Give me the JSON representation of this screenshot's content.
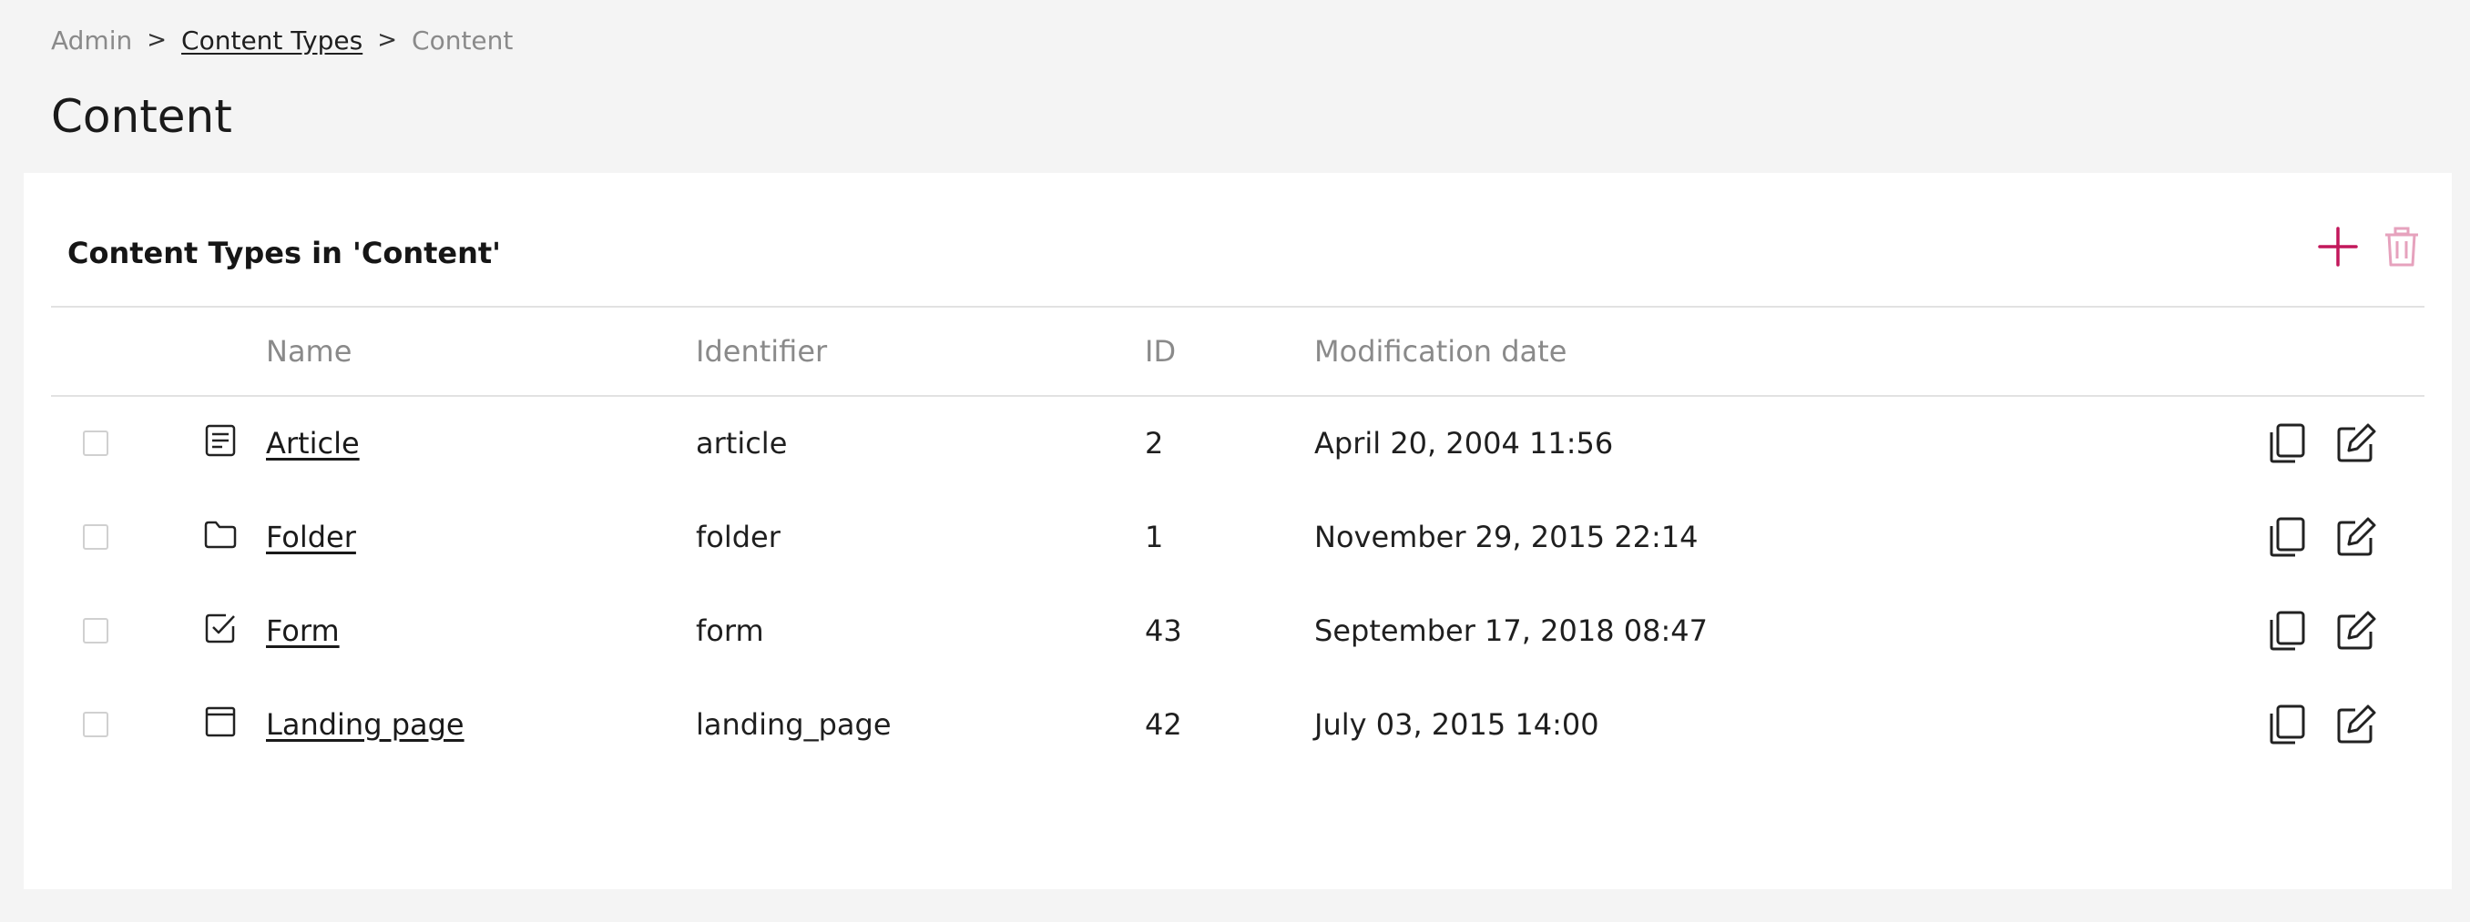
{
  "breadcrumb": {
    "items": [
      {
        "label": "Admin",
        "link": false
      },
      {
        "label": "Content Types",
        "link": true
      },
      {
        "label": "Content",
        "link": false
      }
    ],
    "separator": ">"
  },
  "page": {
    "title": "Content"
  },
  "card": {
    "title": "Content Types in 'Content'",
    "actions": [
      {
        "name": "add",
        "icon": "plus-icon"
      },
      {
        "name": "delete",
        "icon": "trash-icon",
        "disabled": true
      }
    ]
  },
  "table": {
    "columns": [
      "Name",
      "Identifier",
      "ID",
      "Modification date"
    ],
    "rows": [
      {
        "name": "Article",
        "identifier": "article",
        "id": "2",
        "date": "April 20, 2004 11:56",
        "icon": "article-icon"
      },
      {
        "name": "Folder",
        "identifier": "folder",
        "id": "1",
        "date": "November 29, 2015 22:14",
        "icon": "folder-icon"
      },
      {
        "name": "Form",
        "identifier": "form",
        "id": "43",
        "date": "September 17, 2018 08:47",
        "icon": "form-icon"
      },
      {
        "name": "Landing page",
        "identifier": "landing_page",
        "id": "42",
        "date": "July 03, 2015 14:00",
        "icon": "landing-page-icon"
      }
    ],
    "row_actions": [
      {
        "name": "copy",
        "icon": "copy-icon"
      },
      {
        "name": "edit",
        "icon": "edit-icon"
      }
    ]
  },
  "colors": {
    "accent": "#c2185b",
    "accent_disabled": "#e8a3bf",
    "background": "#f4f4f4",
    "card": "#ffffff",
    "border": "#e2e2e2",
    "muted_text": "#8a8a8a"
  }
}
